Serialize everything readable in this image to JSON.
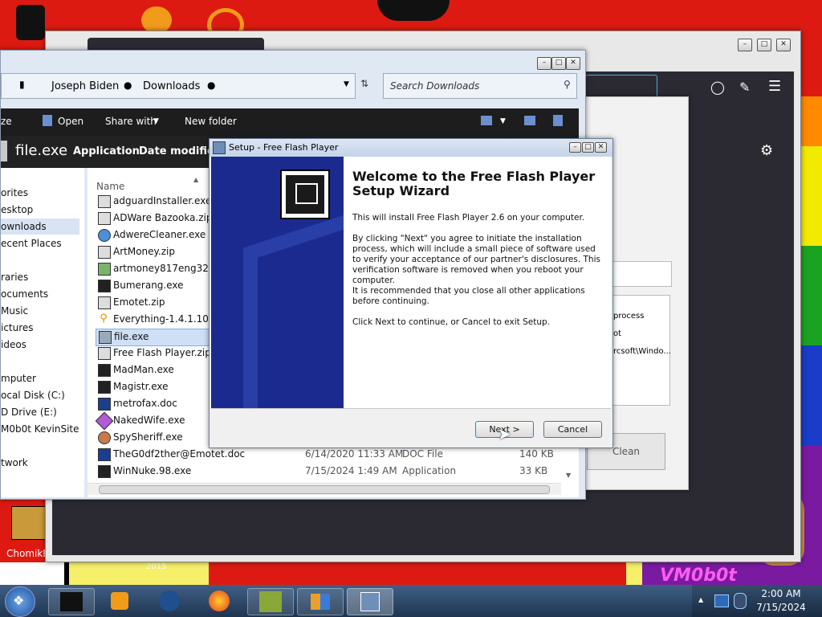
{
  "explorer": {
    "breadcrumb": [
      "Joseph Biden",
      "Downloads"
    ],
    "search_placeholder": "Search Downloads",
    "toolbar": {
      "organize": "ze",
      "open": "Open",
      "share_with": "Share with",
      "new_folder": "New folder"
    },
    "details": {
      "name": "file.exe",
      "type": "Application",
      "date_label": "Date modified"
    },
    "nav_items": [
      "orites",
      "esktop",
      "ownloads",
      "ecent Places",
      "raries",
      "ocuments",
      "Music",
      "ictures",
      "ideos",
      "mputer",
      "ocal Disk (C:)",
      "D Drive (E:)",
      "M0b0t KevinSite",
      "twork"
    ],
    "column_name": "Name",
    "files": [
      {
        "name": "adguardInstaller.exe",
        "date": "",
        "type": "",
        "size": ""
      },
      {
        "name": "ADWare Bazooka.zip",
        "date": "",
        "type": "",
        "size": ""
      },
      {
        "name": "AdwereCleaner.exe",
        "date": "",
        "type": "",
        "size": ""
      },
      {
        "name": "ArtMoney.zip",
        "date": "",
        "type": "",
        "size": ""
      },
      {
        "name": "artmoney817eng32.exe",
        "date": "",
        "type": "",
        "size": ""
      },
      {
        "name": "Bumerang.exe",
        "date": "",
        "type": "",
        "size": ""
      },
      {
        "name": "Emotet.zip",
        "date": "",
        "type": "",
        "size": ""
      },
      {
        "name": "Everything-1.4.1.1024.x",
        "date": "",
        "type": "",
        "size": ""
      },
      {
        "name": "file.exe",
        "date": "",
        "type": "",
        "size": ""
      },
      {
        "name": "Free Flash Player.zip",
        "date": "",
        "type": "",
        "size": ""
      },
      {
        "name": "MadMan.exe",
        "date": "",
        "type": "",
        "size": ""
      },
      {
        "name": "Magistr.exe",
        "date": "",
        "type": "",
        "size": ""
      },
      {
        "name": "metrofax.doc",
        "date": "",
        "type": "",
        "size": ""
      },
      {
        "name": "NakedWife.exe",
        "date": "",
        "type": "",
        "size": ""
      },
      {
        "name": "SpySheriff.exe",
        "date": "",
        "type": "",
        "size": ""
      },
      {
        "name": "TheG0df2ther@Emotet.doc",
        "date": "6/14/2020 11:33 AM",
        "type": "DOC File",
        "size": "140 KB"
      },
      {
        "name": "WinNuke.98.exe",
        "date": "7/15/2024 1:49 AM",
        "type": "Application",
        "size": "33 KB"
      }
    ]
  },
  "cleaner": {
    "rows": [
      "process",
      "ot",
      "rcsoft\\Windo..."
    ],
    "clean_button": "Clean"
  },
  "setup": {
    "title": "Setup - Free Flash Player",
    "heading_line1": "Welcome to the Free Flash Player",
    "heading_line2": "Setup Wizard",
    "p1": "This will install Free Flash Player 2.6 on your computer.",
    "p2": "By clicking \"Next\" you agree to initiate the installation process, which will include a small piece of software used to verify your acceptance of our partner's disclosures. This verification software is removed when you reboot your computer.",
    "p3": "It is recommended that you close all other applications before continuing.",
    "p4": "Click Next to continue, or Cancel to exit Setup.",
    "next_button": "Next >",
    "cancel_button": "Cancel"
  },
  "desktop": {
    "icon_label": "ChomikB",
    "icon_label_2": "2015",
    "watermark": "VM0b0t"
  },
  "taskbar": {
    "time": "2:00 AM",
    "date": "7/15/2024"
  }
}
